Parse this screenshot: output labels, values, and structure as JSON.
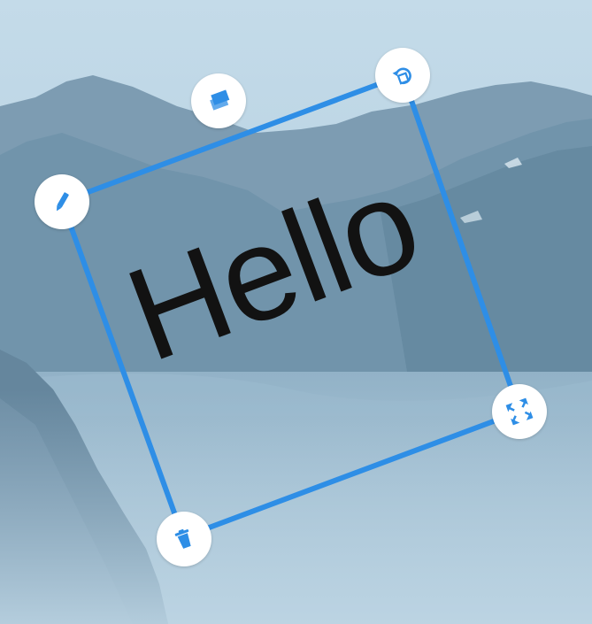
{
  "sticker": {
    "text": "Hello",
    "text_color": "#121212",
    "rotation_deg": -20.5
  },
  "selection": {
    "border_color": "#2e8ee6"
  },
  "handles": [
    {
      "role": "edit",
      "icon": "pencil-icon"
    },
    {
      "role": "layer",
      "icon": "layers-icon"
    },
    {
      "role": "rotate",
      "icon": "rotate-icon"
    },
    {
      "role": "resize",
      "icon": "expand-arrows-icon"
    },
    {
      "role": "delete",
      "icon": "trash-icon"
    }
  ],
  "colors": {
    "accent": "#2e8ee6",
    "handle_bg": "#ffffff",
    "sky": "#b7d3e4",
    "mountain": "#6f8fa6"
  }
}
